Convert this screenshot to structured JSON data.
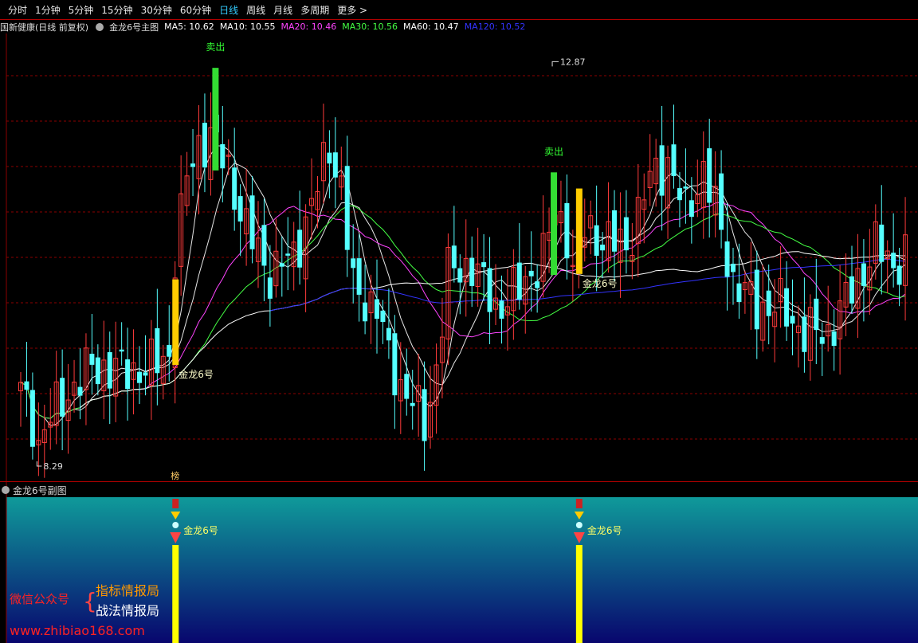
{
  "toolbar": {
    "tabs": [
      "分时",
      "1分钟",
      "5分钟",
      "15分钟",
      "30分钟",
      "60分钟",
      "日线",
      "周线",
      "月线",
      "多周期",
      "更多 >"
    ],
    "active_tab": "日线"
  },
  "main_header": {
    "stock": "国新健康(日线 前复权)",
    "indicator": "金龙6号主图",
    "ma": [
      {
        "label": "MA5: 10.62",
        "color": "#ffffff"
      },
      {
        "label": "MA10: 10.55",
        "color": "#ffffff"
      },
      {
        "label": "MA20: 10.46",
        "color": "#ff44ff"
      },
      {
        "label": "MA30: 10.56",
        "color": "#44ff44"
      },
      {
        "label": "MA60: 10.47",
        "color": "#ffffff"
      },
      {
        "label": "MA120: 10.52",
        "color": "#3333ff"
      }
    ]
  },
  "sub_header": {
    "title": "金龙6号副图"
  },
  "annotations": {
    "signal": "金龙6号",
    "sell": "卖出",
    "low_mark": "8.29",
    "high_mark": "12.87",
    "small_tag": "榜"
  },
  "watermark": {
    "wechat": "微信公众号",
    "brace": "{",
    "line1": "指标情报局",
    "line2": "战法情报局",
    "url": "www.zhibiao168.com"
  },
  "colors": {
    "up": "#ff3b3b",
    "down": "#55ffff",
    "bg": "#000000",
    "grid": "#8b0000",
    "signal_bar": "#ffcc00",
    "sell_bar": "#33dd33",
    "ma20": "#ff44ff",
    "ma30": "#44ff44",
    "ma120": "#3333ff",
    "sub_top": "#0f9a9a",
    "sub_bottom": "#08066e"
  },
  "chart_data": {
    "type": "candlestick",
    "ylim": [
      8.0,
      13.2
    ],
    "candles_count": 150,
    "price_low": 8.29,
    "price_high": 12.87,
    "signal_indices": [
      25,
      93
    ],
    "sell_indices": [
      32,
      89
    ],
    "series": [
      {
        "name": "MA5",
        "color": "#ffffff"
      },
      {
        "name": "MA10",
        "color": "#ffffff"
      },
      {
        "name": "MA20",
        "color": "#ff44ff"
      },
      {
        "name": "MA30",
        "color": "#44ff44"
      },
      {
        "name": "MA60",
        "color": "#ffffff"
      },
      {
        "name": "MA120",
        "color": "#3333ff"
      }
    ],
    "close_keys": [
      [
        0,
        9.0
      ],
      [
        3,
        8.5
      ],
      [
        5,
        8.7
      ],
      [
        8,
        9.0
      ],
      [
        12,
        9.3
      ],
      [
        18,
        9.25
      ],
      [
        22,
        9.3
      ],
      [
        25,
        9.45
      ],
      [
        26,
        10.6
      ],
      [
        28,
        11.5
      ],
      [
        30,
        11.9
      ],
      [
        32,
        12.0
      ],
      [
        35,
        11.6
      ],
      [
        38,
        10.9
      ],
      [
        42,
        10.4
      ],
      [
        46,
        10.6
      ],
      [
        50,
        11.4
      ],
      [
        52,
        11.9
      ],
      [
        54,
        11.4
      ],
      [
        56,
        10.2
      ],
      [
        60,
        10.0
      ],
      [
        62,
        9.4
      ],
      [
        64,
        9.1
      ],
      [
        66,
        8.9
      ],
      [
        68,
        8.6
      ],
      [
        70,
        9.3
      ],
      [
        72,
        10.4
      ],
      [
        76,
        10.5
      ],
      [
        80,
        10.0
      ],
      [
        84,
        10.2
      ],
      [
        88,
        10.6
      ],
      [
        90,
        11.1
      ],
      [
        92,
        10.9
      ],
      [
        93,
        10.4
      ],
      [
        95,
        10.9
      ],
      [
        98,
        10.8
      ],
      [
        102,
        10.7
      ],
      [
        106,
        11.5
      ],
      [
        109,
        11.7
      ],
      [
        112,
        11.1
      ],
      [
        115,
        11.6
      ],
      [
        118,
        10.9
      ],
      [
        120,
        10.3
      ],
      [
        124,
        10.0
      ],
      [
        128,
        10.0
      ],
      [
        132,
        9.7
      ],
      [
        136,
        9.7
      ],
      [
        140,
        10.2
      ],
      [
        144,
        10.7
      ],
      [
        147,
        10.5
      ],
      [
        149,
        10.6
      ]
    ]
  }
}
